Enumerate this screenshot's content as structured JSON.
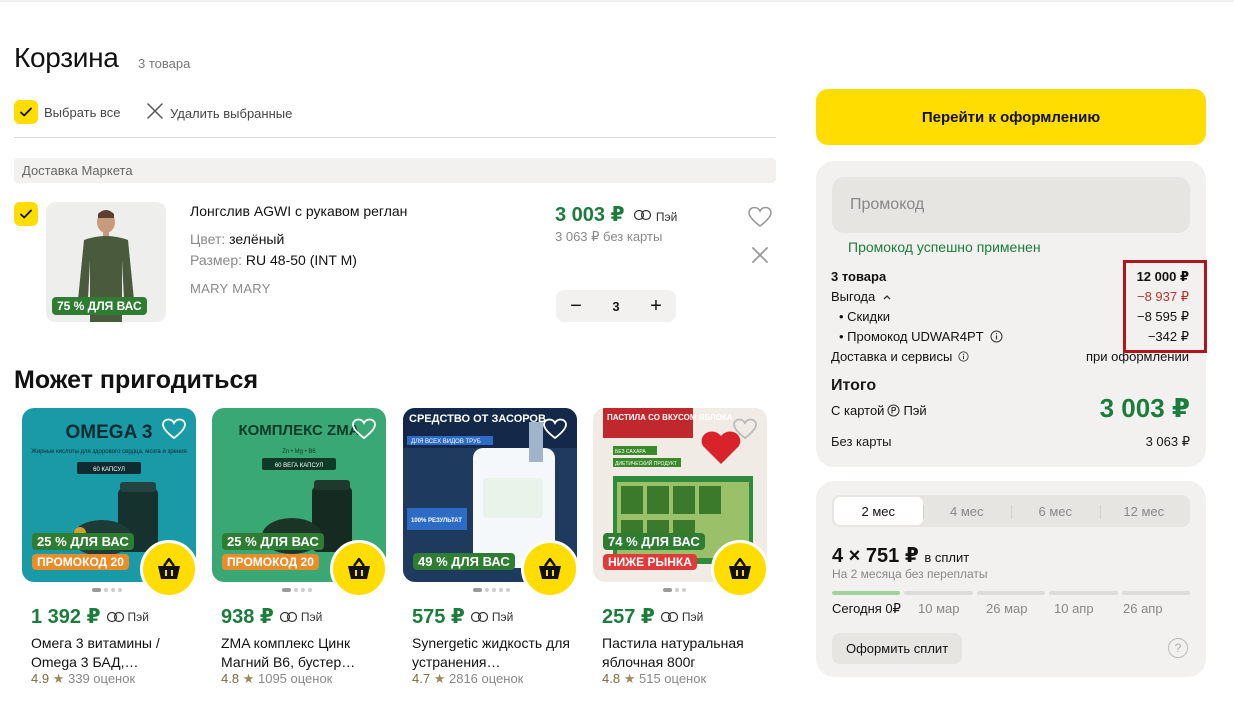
{
  "header": {
    "title": "Корзина",
    "count": "3 товара",
    "select_all": "Выбрать все",
    "delete_selected": "Удалить выбранные"
  },
  "delivery": {
    "label": "Доставка Маркета"
  },
  "cart_item": {
    "title": "Лонгслив AGWI с рукавом реглан",
    "color_label": "Цвет:",
    "color_value": "зелёный",
    "size_label": "Размер:",
    "size_value": "RU 48-50 (INT M)",
    "brand": "MARY MARY",
    "badge": "75 % ДЛЯ ВАС",
    "price": "3 003 ₽",
    "pay_label": "Пэй",
    "old_price": "3 063 ₽ без карты",
    "quantity": "3",
    "minus": "−",
    "plus": "+"
  },
  "recommendations": {
    "title": "Может пригодиться",
    "cards": [
      {
        "tag": "25 % ДЛЯ ВАС",
        "tag2": "ПРОМОКОД 20",
        "price": "1 392 ₽",
        "pay": "Пэй",
        "name": "Омега 3 витамины / Omega 3 БАД,…",
        "rating": "4.9",
        "reviews": "339 оценок",
        "img_title": "OMEGA 3",
        "img_sub": "Жирные кислоты для здорового сердца, мозга и зрения",
        "img_caps": "60 КАПСУЛ",
        "img_color": "#1a9aa6"
      },
      {
        "tag": "25 % ДЛЯ ВАС",
        "tag2": "ПРОМОКОД 20",
        "price": "938 ₽",
        "pay": "Пэй",
        "name": "ZMA комплекс Цинк Магний B6, бустер…",
        "rating": "4.8",
        "reviews": "1095 оценок",
        "img_title": "КОМПЛЕКС ZMA",
        "img_sub": "Zn • Mg • B6",
        "img_caps": "60 ВЕГА КАПСУЛ",
        "img_color": "#3aa874"
      },
      {
        "tag": "49 % ДЛЯ ВАС",
        "tag2": "",
        "price": "575 ₽",
        "pay": "Пэй",
        "name": "Synergetic жидкость для устранения…",
        "rating": "4.7",
        "reviews": "2816 оценок",
        "img_title": "СРЕДСТВО ОТ ЗАСОРОВ",
        "img_sub": "ДЛЯ ВСЕХ ВИДОВ ТРУБ",
        "img_caps": "100% РЕЗУЛЬТАТ",
        "img_color": "#1e3a5f"
      },
      {
        "tag": "74 % ДЛЯ ВАС",
        "tag2": "НИЖЕ РЫНКА",
        "price": "257 ₽",
        "pay": "Пэй",
        "name": "Пастила натуральная яблочная 800г",
        "rating": "4.8",
        "reviews": "515 оценок",
        "img_title": "ПАСТИЛА СО ВКУСОМ ЯБЛОКА",
        "img_sub": "БЕЗ САХАРА",
        "img_caps": "ДИЕТИЧЕСКИЙ ПРОДУКТ",
        "img_color": "#f0ebe4"
      }
    ]
  },
  "summary": {
    "checkout": "Перейти к оформлению",
    "promo_placeholder": "Промокод",
    "promo_success": "Промокод успешно применен",
    "goods_label": "3 товара",
    "goods_value": "12 000 ₽",
    "benefit_label": "Выгода",
    "benefit_value": "−8 937 ₽",
    "discounts_label": "• Скидки",
    "discounts_value": "−8 595 ₽",
    "promo_label": "• Промокод UDWAR4PT",
    "promo_value": "−342 ₽",
    "delivery_label": "Доставка и сервисы",
    "delivery_value": "при оформлении",
    "total_label": "Итого",
    "with_card_label": "С картой",
    "with_card_pay": "Пэй",
    "total_price": "3 003 ₽",
    "without_card_label": "Без карты",
    "without_card_value": "3 063 ₽"
  },
  "split": {
    "tabs": [
      "2 мес",
      "4 мес",
      "6 мес",
      "12 мес"
    ],
    "active_tab": "2 мес",
    "amount": "4 × 751 ₽",
    "amount_suffix": "в сплит",
    "subtitle": "На 2 месяца без переплаты",
    "dates": [
      "Сегодня 0₽",
      "10 мар",
      "26 мар",
      "10 апр",
      "26 апр"
    ],
    "button": "Оформить сплит",
    "help": "?"
  },
  "colors": {
    "accent_yellow": "#ffdd00",
    "price_green": "#1c7c3c",
    "discount_red": "#b5342a",
    "highlight_box": "#b0161c"
  }
}
